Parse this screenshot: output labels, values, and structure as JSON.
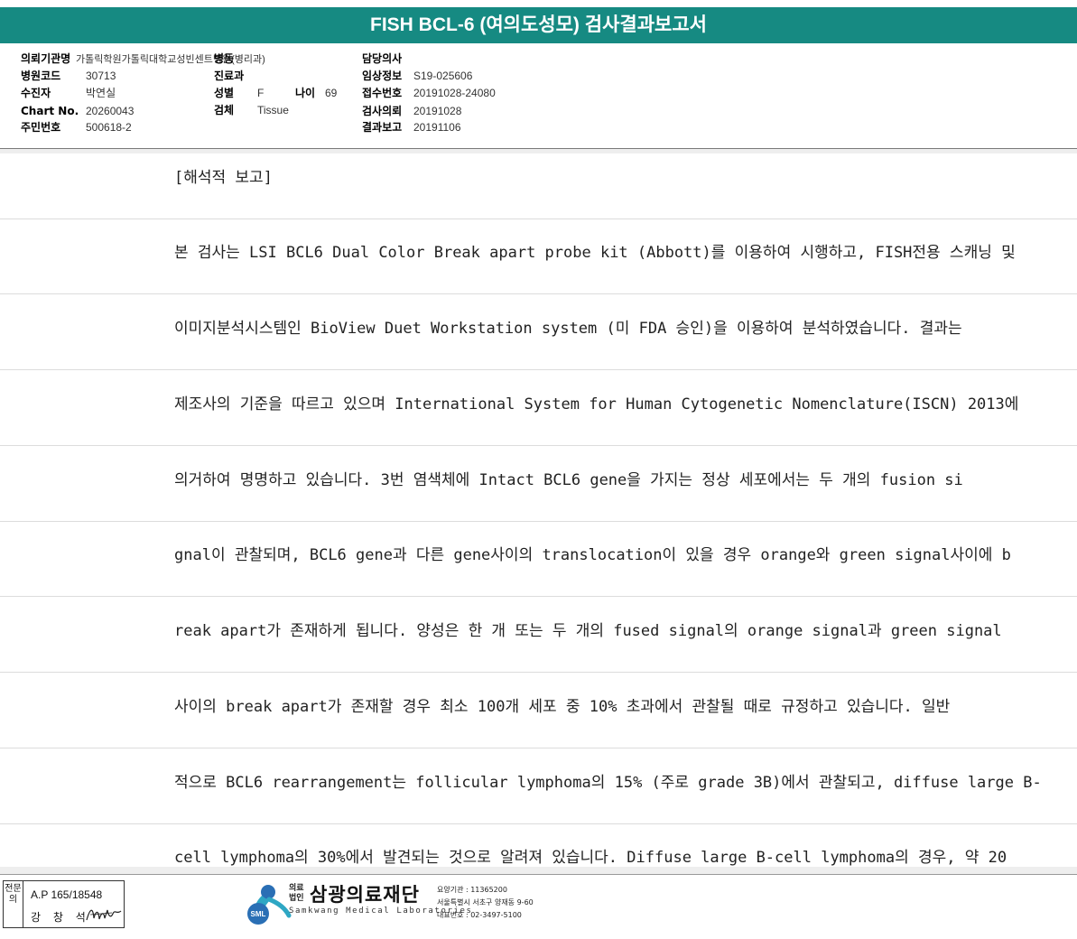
{
  "report": {
    "title": "FISH BCL-6 (여의도성모) 검사결과보고서"
  },
  "info": {
    "requesting_institution": {
      "label": "의뢰기관명",
      "value": "가톨릭학원가톨릭대학교성빈센트병원(병리과)"
    },
    "ward": {
      "label": "병동"
    },
    "hospital_code": {
      "label": "병원코드",
      "value": "30713"
    },
    "recipient": {
      "label": "수진자",
      "value": "박연실"
    },
    "chart_no": {
      "label": "Chart No.",
      "value": "20260043"
    },
    "resident_no": {
      "label": "주민번호",
      "value": "500618-2"
    },
    "department": {
      "label": "진료과"
    },
    "sex": {
      "label": "성별",
      "value": "F"
    },
    "age": {
      "label": "나이",
      "value": "69"
    },
    "specimen": {
      "label": "검체",
      "value": "Tissue"
    },
    "physician": {
      "label": "담당의사"
    },
    "clinical_info": {
      "label": "임상정보",
      "value": "S19-025606"
    },
    "accession_no": {
      "label": "접수번호",
      "value": "20191028-24080"
    },
    "test_request": {
      "label": "검사의뢰",
      "value": "20191028"
    },
    "result_report": {
      "label": "결과보고",
      "value": "20191106"
    }
  },
  "body_lines": [
    "[해석적 보고]",
    "본 검사는 LSI BCL6 Dual Color Break apart probe kit (Abbott)를 이용하여 시행하고, FISH전용 스캐닝 및",
    " 이미지분석시스템인 BioView Duet Workstation system (미 FDA 승인)을 이용하여 분석하였습니다. 결과는",
    "제조사의 기준을 따르고 있으며 International System for Human Cytogenetic Nomenclature(ISCN) 2013에",
    "의거하여 명명하고 있습니다. 3번 염색체에 Intact BCL6 gene을 가지는 정상 세포에서는 두 개의 fusion si",
    "gnal이 관찰되며, BCL6 gene과 다른 gene사이의 translocation이 있을 경우 orange와 green signal사이에 b",
    "reak apart가 존재하게 됩니다. 양성은 한 개 또는 두 개의 fused signal의 orange signal과 green signal",
    "사이의 break apart가 존재할 경우 최소 100개 세포 중 10% 초과에서 관찰될 때로 규정하고 있습니다. 일반",
    "적으로 BCL6 rearrangement는 follicular lymphoma의 15% (주로 grade 3B)에서 관찰되고, diffuse large B-",
    "cell lymphoma의 30%에서 발견되는 것으로 알려져 있습니다. Diffuse large B-cell lymphoma의 경우, 약 20"
  ],
  "footer": {
    "sign_box": {
      "side_label": "전문의",
      "ap_number": "A.P 165/18548",
      "name": "강 창 석"
    },
    "org": {
      "small_label": "의료법인",
      "name_ko": "삼광의료재단",
      "name_en": "Samkwang Medical Laboratories",
      "logo_text": "SML",
      "institution_code": "요양기관 : 11365200",
      "address": "서울특별시 서초구 양재동 9-60",
      "phone": "대표번호 : 02-3497-5100"
    }
  },
  "colors": {
    "header_bg": "#168a82",
    "logo_blue": "#2a6fb5",
    "logo_teal": "#2ea7c4"
  }
}
